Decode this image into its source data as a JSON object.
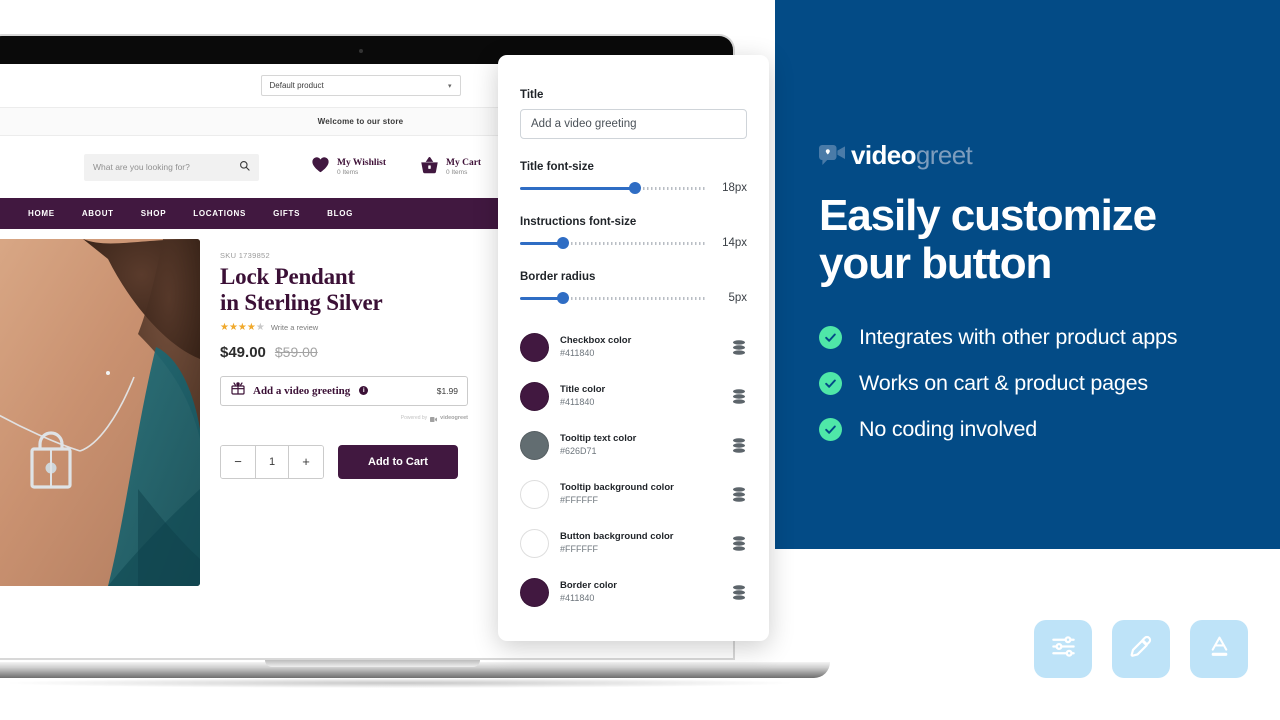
{
  "brand": {
    "logo_text_primary": "video",
    "logo_text_secondary": "greet",
    "logo_icon": "video-camera-bubble-icon",
    "headline_line1": "Easily customize",
    "headline_line2": "your button",
    "panel_color": "#034B86",
    "check_color": "#4FE7A8",
    "bullets": [
      {
        "label": "Integrates with other product apps",
        "icon": "check-circle-icon"
      },
      {
        "label": "Works on cart & product pages",
        "icon": "check-circle-icon"
      },
      {
        "label": "No coding involved",
        "icon": "check-circle-icon"
      }
    ]
  },
  "feature_badges": [
    {
      "icon": "sliders-icon"
    },
    {
      "icon": "eyedropper-icon"
    },
    {
      "icon": "text-color-icon"
    }
  ],
  "store": {
    "product_select": {
      "value": "Default product",
      "caret": "chevron-down-icon"
    },
    "welcome_text": "Welcome to our store",
    "search": {
      "placeholder": "What are you looking for?",
      "icon": "search-icon"
    },
    "actions": [
      {
        "icon": "heart-icon",
        "title": "My Wishlist",
        "sub": "0 Items"
      },
      {
        "icon": "basket-icon",
        "title": "My Cart",
        "sub": "0 Items"
      }
    ],
    "nav": [
      "HOME",
      "ABOUT",
      "SHOP",
      "LOCATIONS",
      "GIFTS",
      "BLOG"
    ],
    "nav_bg": "#411840",
    "product": {
      "sku": "SKU 1739852",
      "title_line1": "Lock Pendant",
      "title_line2": "in Sterling Silver",
      "rating_filled": 4,
      "rating_total": 5,
      "review_link": "Write a review",
      "price_current": "$49.00",
      "price_compare": "$59.00",
      "greeting_option": {
        "icon": "gift-box-icon",
        "label": "Add a video greeting",
        "info_icon": "info-icon",
        "price": "$1.99"
      },
      "powered_by": {
        "prefix": "Powered by",
        "brand": "videogreet"
      },
      "quantity": {
        "decrease": "−",
        "value": "1",
        "increase": "+"
      },
      "add_to_cart": "Add to Cart"
    }
  },
  "settings_panel": {
    "title_label": "Title",
    "title_value": "Add a video greeting",
    "sliders": [
      {
        "label": "Title font-size",
        "value": "18px",
        "percent": 62
      },
      {
        "label": "Instructions font-size",
        "value": "14px",
        "percent": 23
      },
      {
        "label": "Border radius",
        "value": "5px",
        "percent": 23
      }
    ],
    "colors": [
      {
        "name": "Checkbox color",
        "hex": "#411840",
        "swatch": "#411840",
        "picker_icon": "color-stack-icon"
      },
      {
        "name": "Title color",
        "hex": "#411840",
        "swatch": "#411840",
        "picker_icon": "color-stack-icon"
      },
      {
        "name": "Tooltip text color",
        "hex": "#626D71",
        "swatch": "#626D71",
        "picker_icon": "color-stack-icon"
      },
      {
        "name": "Tooltip background color",
        "hex": "#FFFFFF",
        "swatch": "#FFFFFF",
        "picker_icon": "color-stack-icon"
      },
      {
        "name": "Button background color",
        "hex": "#FFFFFF",
        "swatch": "#FFFFFF",
        "picker_icon": "color-stack-icon"
      },
      {
        "name": "Border color",
        "hex": "#411840",
        "swatch": "#411840",
        "picker_icon": "color-stack-icon"
      }
    ]
  }
}
